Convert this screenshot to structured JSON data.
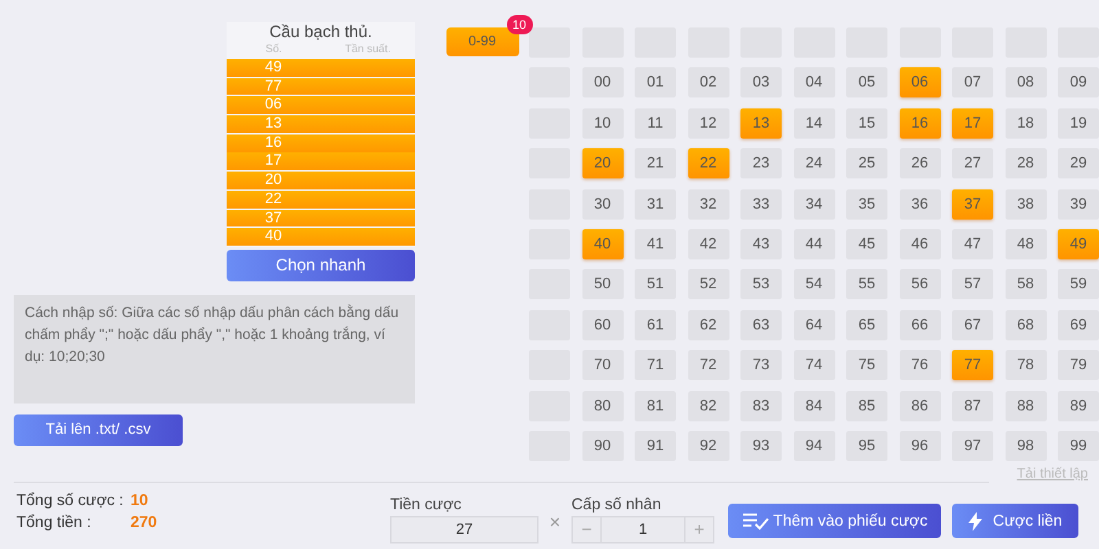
{
  "hot_numbers": {
    "title": "Cầu bạch thủ.",
    "headers": [
      "Số.",
      "Tần suất."
    ],
    "numbers": [
      "49",
      "77",
      "06",
      "13",
      "16",
      "17",
      "20",
      "22",
      "37",
      "40"
    ]
  },
  "quick_pick_button": "Chọn nhanh",
  "hint": "Cách nhập số: Giữa các số nhập dấu phân cách bằng dấu chấm phẩy \";\" hoặc dấu phẩy \",\" hoặc 1 khoảng trắng, ví dụ: 10;20;30",
  "upload_button": "Tải lên .txt/ .csv",
  "range_button": {
    "label": "0-99",
    "badge": "10"
  },
  "grid": [
    [
      {
        "label": "00",
        "selected": false
      },
      {
        "label": "01",
        "selected": false
      },
      {
        "label": "02",
        "selected": false
      },
      {
        "label": "03",
        "selected": false
      },
      {
        "label": "04",
        "selected": false
      },
      {
        "label": "05",
        "selected": false
      },
      {
        "label": "06",
        "selected": true
      },
      {
        "label": "07",
        "selected": false
      },
      {
        "label": "08",
        "selected": false
      },
      {
        "label": "09",
        "selected": false
      }
    ],
    [
      {
        "label": "10",
        "selected": false
      },
      {
        "label": "11",
        "selected": false
      },
      {
        "label": "12",
        "selected": false
      },
      {
        "label": "13",
        "selected": true
      },
      {
        "label": "14",
        "selected": false
      },
      {
        "label": "15",
        "selected": false
      },
      {
        "label": "16",
        "selected": true
      },
      {
        "label": "17",
        "selected": true
      },
      {
        "label": "18",
        "selected": false
      },
      {
        "label": "19",
        "selected": false
      }
    ],
    [
      {
        "label": "20",
        "selected": true
      },
      {
        "label": "21",
        "selected": false
      },
      {
        "label": "22",
        "selected": true
      },
      {
        "label": "23",
        "selected": false
      },
      {
        "label": "24",
        "selected": false
      },
      {
        "label": "25",
        "selected": false
      },
      {
        "label": "26",
        "selected": false
      },
      {
        "label": "27",
        "selected": false
      },
      {
        "label": "28",
        "selected": false
      },
      {
        "label": "29",
        "selected": false
      }
    ],
    [
      {
        "label": "30",
        "selected": false
      },
      {
        "label": "31",
        "selected": false
      },
      {
        "label": "32",
        "selected": false
      },
      {
        "label": "33",
        "selected": false
      },
      {
        "label": "34",
        "selected": false
      },
      {
        "label": "35",
        "selected": false
      },
      {
        "label": "36",
        "selected": false
      },
      {
        "label": "37",
        "selected": true
      },
      {
        "label": "38",
        "selected": false
      },
      {
        "label": "39",
        "selected": false
      }
    ],
    [
      {
        "label": "40",
        "selected": true
      },
      {
        "label": "41",
        "selected": false
      },
      {
        "label": "42",
        "selected": false
      },
      {
        "label": "43",
        "selected": false
      },
      {
        "label": "44",
        "selected": false
      },
      {
        "label": "45",
        "selected": false
      },
      {
        "label": "46",
        "selected": false
      },
      {
        "label": "47",
        "selected": false
      },
      {
        "label": "48",
        "selected": false
      },
      {
        "label": "49",
        "selected": true
      }
    ],
    [
      {
        "label": "50",
        "selected": false
      },
      {
        "label": "51",
        "selected": false
      },
      {
        "label": "52",
        "selected": false
      },
      {
        "label": "53",
        "selected": false
      },
      {
        "label": "54",
        "selected": false
      },
      {
        "label": "55",
        "selected": false
      },
      {
        "label": "56",
        "selected": false
      },
      {
        "label": "57",
        "selected": false
      },
      {
        "label": "58",
        "selected": false
      },
      {
        "label": "59",
        "selected": false
      }
    ],
    [
      {
        "label": "60",
        "selected": false
      },
      {
        "label": "61",
        "selected": false
      },
      {
        "label": "62",
        "selected": false
      },
      {
        "label": "63",
        "selected": false
      },
      {
        "label": "64",
        "selected": false
      },
      {
        "label": "65",
        "selected": false
      },
      {
        "label": "66",
        "selected": false
      },
      {
        "label": "67",
        "selected": false
      },
      {
        "label": "68",
        "selected": false
      },
      {
        "label": "69",
        "selected": false
      }
    ],
    [
      {
        "label": "70",
        "selected": false
      },
      {
        "label": "71",
        "selected": false
      },
      {
        "label": "72",
        "selected": false
      },
      {
        "label": "73",
        "selected": false
      },
      {
        "label": "74",
        "selected": false
      },
      {
        "label": "75",
        "selected": false
      },
      {
        "label": "76",
        "selected": false
      },
      {
        "label": "77",
        "selected": true
      },
      {
        "label": "78",
        "selected": false
      },
      {
        "label": "79",
        "selected": false
      }
    ],
    [
      {
        "label": "80",
        "selected": false
      },
      {
        "label": "81",
        "selected": false
      },
      {
        "label": "82",
        "selected": false
      },
      {
        "label": "83",
        "selected": false
      },
      {
        "label": "84",
        "selected": false
      },
      {
        "label": "85",
        "selected": false
      },
      {
        "label": "86",
        "selected": false
      },
      {
        "label": "87",
        "selected": false
      },
      {
        "label": "88",
        "selected": false
      },
      {
        "label": "89",
        "selected": false
      }
    ],
    [
      {
        "label": "90",
        "selected": false
      },
      {
        "label": "91",
        "selected": false
      },
      {
        "label": "92",
        "selected": false
      },
      {
        "label": "93",
        "selected": false
      },
      {
        "label": "94",
        "selected": false
      },
      {
        "label": "95",
        "selected": false
      },
      {
        "label": "96",
        "selected": false
      },
      {
        "label": "97",
        "selected": false
      },
      {
        "label": "98",
        "selected": false
      },
      {
        "label": "99",
        "selected": false
      }
    ]
  ],
  "reset_link": "Tải thiết lập",
  "summary": [
    {
      "label": "Tổng số cược :",
      "value": "10"
    },
    {
      "label": "Tổng tiền :",
      "value": "270"
    }
  ],
  "stake": {
    "label": "Tiền cược",
    "value": "27"
  },
  "times_sign": "×",
  "multiplier": {
    "label": "Cấp số nhân",
    "value": "1",
    "minus": "−",
    "plus": "+"
  },
  "add_to_slip_button": "Thêm vào phiếu cược",
  "bet_now_button": "Cược liền"
}
